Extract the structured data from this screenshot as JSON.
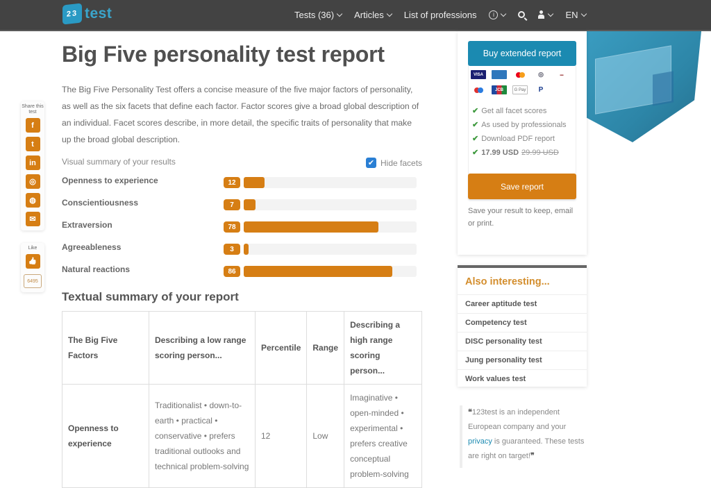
{
  "header": {
    "logo_text": "test",
    "logo_cube_text": "23",
    "nav": [
      {
        "label": "Tests (36)",
        "icon": "chevron-down-icon"
      },
      {
        "label": "Articles",
        "icon": "chevron-down-icon"
      },
      {
        "label": "List of professions"
      }
    ],
    "info_icon": "i",
    "language": "EN"
  },
  "share": {
    "label": "Share this test",
    "buttons": [
      {
        "name": "facebook",
        "glyph": "f"
      },
      {
        "name": "twitter",
        "glyph": "t"
      },
      {
        "name": "linkedin",
        "glyph": "in"
      },
      {
        "name": "instagram",
        "glyph": "◎"
      },
      {
        "name": "messenger",
        "glyph": "◍"
      },
      {
        "name": "email",
        "glyph": "✉"
      }
    ],
    "like_label": "Like",
    "like_glyph": "👍",
    "like_count": "6495"
  },
  "main": {
    "title": "Big Five personality test report",
    "intro": "The Big Five Personality Test offers a concise measure of the five major factors of personality, as well as the six facets that define each factor. Factor scores give a broad global description of an individual. Facet scores describe, in more detail, the specific traits of personality that make up the broad global description.",
    "visual_summary_label": "Visual summary of your results",
    "hide_facets_label": "Hide facets",
    "hide_facets_checked": true,
    "accent_color": "#d67e14",
    "factors": [
      {
        "name": "Openness to experience",
        "score": 12
      },
      {
        "name": "Conscientiousness",
        "score": 7
      },
      {
        "name": "Extraversion",
        "score": 78
      },
      {
        "name": "Agreeableness",
        "score": 3
      },
      {
        "name": "Natural reactions",
        "score": 86
      }
    ],
    "textual_summary_title": "Textual summary of your report",
    "table": {
      "headers": [
        "The Big Five Factors",
        "Describing a low range scoring person...",
        "Percentile",
        "Range",
        "Describing a high range scoring person..."
      ],
      "rows": [
        {
          "factor": "Openness to experience",
          "low": "Traditionalist • down-to-earth • practical • conservative • prefers traditional outlooks and technical problem-solving",
          "percentile": "12",
          "range": "Low",
          "high": "Imaginative • open-minded • experimental • prefers creative conceptual problem-solving"
        }
      ]
    }
  },
  "sidebar": {
    "buy_button": "Buy extended report",
    "payment_methods": [
      "VISA",
      "AMEX",
      "Mastercard",
      "Diners Club",
      "Discover",
      "Maestro",
      "JCB",
      "G Pay",
      "PayPal"
    ],
    "features": [
      "Get all facet scores",
      "As used by professionals",
      "Download PDF report"
    ],
    "price": "17.99 USD",
    "old_price": "29.99 USD",
    "save_button": "Save report",
    "save_note": "Save your result to keep, email or print.",
    "also_title": "Also interesting...",
    "also_items": [
      "Career aptitude test",
      "Competency test",
      "DISC personality test",
      "Jung personality test",
      "Work values test"
    ],
    "quote_before": "123test is an independent European company and your ",
    "quote_link": "privacy",
    "quote_after": " is guaranteed. These tests are right on target!"
  }
}
